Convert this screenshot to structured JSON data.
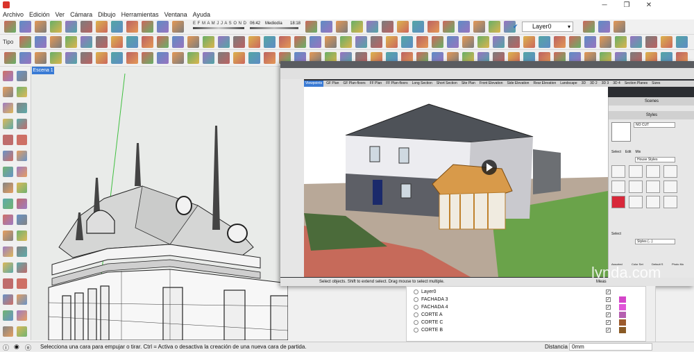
{
  "window": {
    "min_label": "─",
    "max_label": "❐",
    "close_label": "✕"
  },
  "menu": [
    "Archivo",
    "Edición",
    "Ver",
    "Cámara",
    "Dibujo",
    "Herramientas",
    "Ventana",
    "Ayuda"
  ],
  "toolbar": {
    "tipo_label": "Tipo",
    "shadow_months": "E F M A M J J A S O N D",
    "time_start": "06:42",
    "time_mid": "Mediodía",
    "time_end": "18:18",
    "layer_value": "Layer0"
  },
  "scene_tab": "Escena 1",
  "video": {
    "tabs": [
      "Viewpoints",
      "GF Plan",
      "GF Plan-floors",
      "FF Plan",
      "FF Plan-floors",
      "Long Section",
      "Short Section",
      "Site Plan",
      "Front Elevation",
      "Side Elevation",
      "Rear Elevation",
      "Landscape",
      "3D",
      "3D 2",
      "3D 3",
      "3D 4",
      "Section Planes",
      "Sizes"
    ],
    "status_text": "Select objects. Shift to extend select. Drag mouse to select multiple.",
    "meas_label": "Meas",
    "scenes_title": "Scenes",
    "styles_title": "Styles",
    "style_name": "NO CUT",
    "panel_tabs": [
      "Select",
      "Edit",
      "Mix"
    ],
    "style_dropdown": "House Styles",
    "select_label": "Select",
    "styles_dropdown2": "Styles (...)",
    "thumb_labels": [
      "Assorted",
      "Color Set",
      "Default S",
      "Photo Mo"
    ],
    "watermark": "lynda.com"
  },
  "layers": [
    {
      "name": "Layer0",
      "checked": true,
      "color": ""
    },
    {
      "name": "FACHADA 3",
      "checked": true,
      "color": "#d445c9"
    },
    {
      "name": "FACHADA 4",
      "checked": true,
      "color": "#e055d8"
    },
    {
      "name": "CORTE A",
      "checked": true,
      "color": "#b65fb0"
    },
    {
      "name": "CORTE C",
      "checked": true,
      "color": "#9c5a2c"
    },
    {
      "name": "CORTE B",
      "checked": true,
      "color": "#8a5a25"
    }
  ],
  "status": {
    "text": "Selecciona una cara para empujar o tirar. Ctrl = Activa o desactiva la creación de una nueva cara de partida.",
    "distance_label": "Distancia",
    "distance_value": "0mm"
  }
}
